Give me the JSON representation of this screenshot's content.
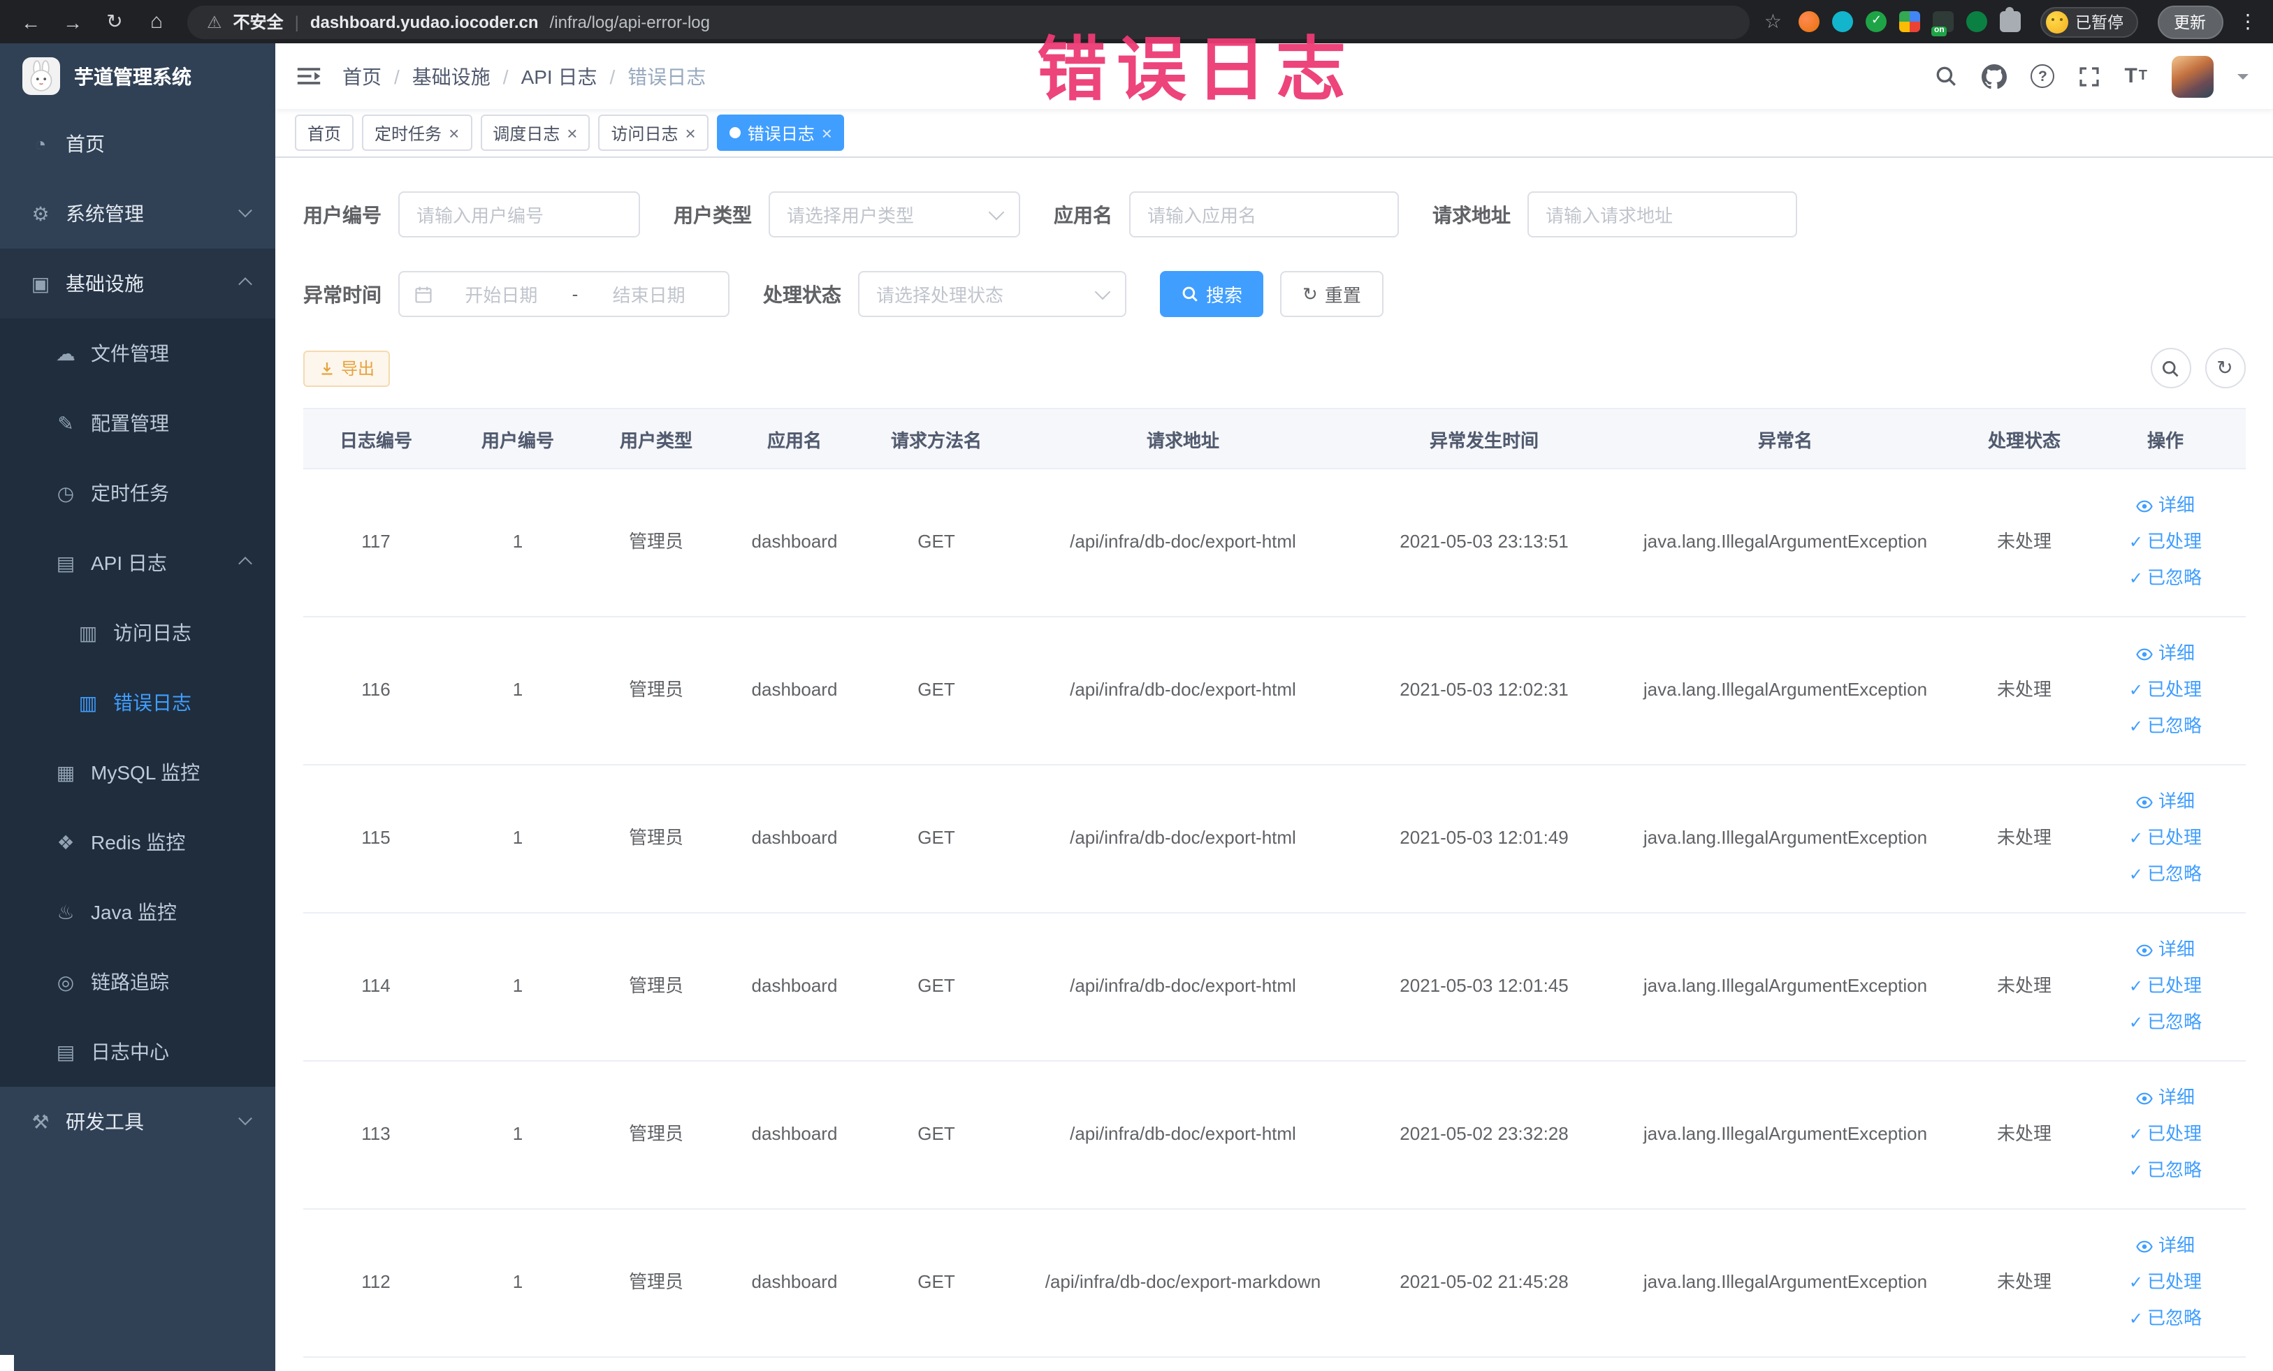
{
  "overlay": {
    "text": "错误日志",
    "color": "#ed3a74"
  },
  "browser": {
    "security_label": "不安全",
    "url_host": "dashboard.yudao.iocoder.cn",
    "url_path": "/infra/log/api-error-log",
    "on_badge_label": "on",
    "paused_label": "已暂停",
    "update_label": "更新"
  },
  "sidebar": {
    "logo_title": "芋道管理系统",
    "items": [
      {
        "label": "首页",
        "icon": "dashboard-icon",
        "level": 1
      },
      {
        "label": "系统管理",
        "icon": "gear-icon",
        "level": 1,
        "chevron": "down"
      },
      {
        "label": "基础设施",
        "icon": "monitor-icon",
        "level": 1,
        "chevron": "up",
        "open": true
      },
      {
        "label": "文件管理",
        "icon": "cloud-icon",
        "level": 2
      },
      {
        "label": "配置管理",
        "icon": "edit-icon",
        "level": 2
      },
      {
        "label": "定时任务",
        "icon": "clock-icon",
        "level": 2
      },
      {
        "label": "API 日志",
        "icon": "document-icon",
        "level": 2,
        "chevron": "up",
        "open": true
      },
      {
        "label": "访问日志",
        "icon": "log-icon",
        "level": 3
      },
      {
        "label": "错误日志",
        "icon": "log-icon",
        "level": 3,
        "active": true
      },
      {
        "label": "MySQL 监控",
        "icon": "database-icon",
        "level": 2
      },
      {
        "label": "Redis 监控",
        "icon": "redis-icon",
        "level": 2
      },
      {
        "label": "Java 监控",
        "icon": "java-icon",
        "level": 2
      },
      {
        "label": "链路追踪",
        "icon": "trace-icon",
        "level": 2
      },
      {
        "label": "日志中心",
        "icon": "log-center-icon",
        "level": 2
      },
      {
        "label": "研发工具",
        "icon": "tools-icon",
        "level": 1,
        "chevron": "down"
      }
    ]
  },
  "header": {
    "breadcrumb": [
      "首页",
      "基础设施",
      "API 日志",
      "错误日志"
    ]
  },
  "tabs": [
    {
      "label": "首页",
      "closable": false,
      "active": false
    },
    {
      "label": "定时任务",
      "closable": true,
      "active": false
    },
    {
      "label": "调度日志",
      "closable": true,
      "active": false
    },
    {
      "label": "访问日志",
      "closable": true,
      "active": false
    },
    {
      "label": "错误日志",
      "closable": true,
      "active": true
    }
  ],
  "filters": {
    "user_id": {
      "label": "用户编号",
      "placeholder": "请输入用户编号"
    },
    "user_type": {
      "label": "用户类型",
      "placeholder": "请选择用户类型"
    },
    "app_name": {
      "label": "应用名",
      "placeholder": "请输入应用名"
    },
    "request_url": {
      "label": "请求地址",
      "placeholder": "请输入请求地址"
    },
    "exception_time": {
      "label": "异常时间",
      "start_placeholder": "开始日期",
      "separator": "-",
      "end_placeholder": "结束日期"
    },
    "process_status": {
      "label": "处理状态",
      "placeholder": "请选择处理状态"
    },
    "search_label": "搜索",
    "reset_label": "重置"
  },
  "toolbar": {
    "export_label": "导出"
  },
  "table": {
    "columns": [
      "日志编号",
      "用户编号",
      "用户类型",
      "应用名",
      "请求方法名",
      "请求地址",
      "异常发生时间",
      "异常名",
      "处理状态",
      "操作"
    ],
    "rows": [
      [
        "117",
        "1",
        "管理员",
        "dashboard",
        "GET",
        "/api/infra/db-doc/export-html",
        "2021-05-03 23:13:51",
        "java.lang.IllegalArgumentException",
        "未处理"
      ],
      [
        "116",
        "1",
        "管理员",
        "dashboard",
        "GET",
        "/api/infra/db-doc/export-html",
        "2021-05-03 12:02:31",
        "java.lang.IllegalArgumentException",
        "未处理"
      ],
      [
        "115",
        "1",
        "管理员",
        "dashboard",
        "GET",
        "/api/infra/db-doc/export-html",
        "2021-05-03 12:01:49",
        "java.lang.IllegalArgumentException",
        "未处理"
      ],
      [
        "114",
        "1",
        "管理员",
        "dashboard",
        "GET",
        "/api/infra/db-doc/export-html",
        "2021-05-03 12:01:45",
        "java.lang.IllegalArgumentException",
        "未处理"
      ],
      [
        "113",
        "1",
        "管理员",
        "dashboard",
        "GET",
        "/api/infra/db-doc/export-html",
        "2021-05-02 23:32:28",
        "java.lang.IllegalArgumentException",
        "未处理"
      ],
      [
        "112",
        "1",
        "管理员",
        "dashboard",
        "GET",
        "/api/infra/db-doc/export-markdown",
        "2021-05-02 21:45:28",
        "java.lang.IllegalArgumentException",
        "未处理"
      ]
    ],
    "actions": [
      {
        "name": "detail-link",
        "label": "详细",
        "icon": "eye-icon"
      },
      {
        "name": "mark-processed-link",
        "label": "已处理",
        "icon": "check-icon"
      },
      {
        "name": "mark-ignored-link",
        "label": "已忽略",
        "icon": "check-icon"
      }
    ]
  },
  "theme": {
    "accent": "#409eff",
    "sidebar_bg": "#304156",
    "submenu_bg": "#1f2d3d",
    "warning": "#e6a23c"
  }
}
